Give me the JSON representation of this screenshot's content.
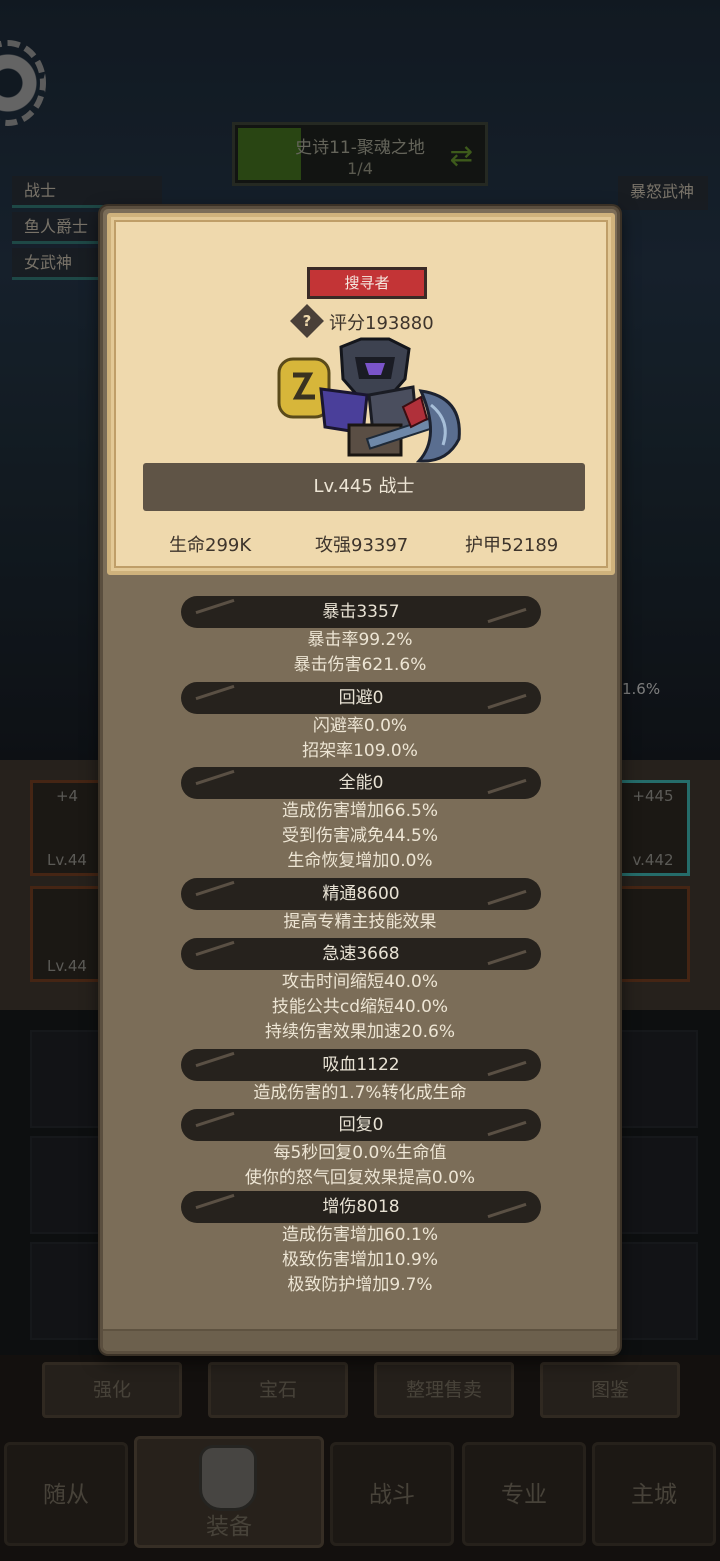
{
  "stage": {
    "title": "史诗11-聚魂之地",
    "progress": "1/4",
    "progress_fraction": 0.25
  },
  "team": [
    "战士",
    "鱼人爵士",
    "女武神"
  ],
  "enemy_label": "暴怒武神",
  "side_percent": "1.6%",
  "equip_slots": {
    "top_left_plus": "+4",
    "top_left_lv": "Lv.44",
    "bottom_left_lv": "Lv.44",
    "top_right_plus": "+445",
    "top_right_lv": "v.442"
  },
  "menu": [
    "强化",
    "宝石",
    "整理售卖",
    "图鉴"
  ],
  "tabs": [
    "随从",
    "装备",
    "战斗",
    "专业",
    "主城"
  ],
  "hero": {
    "role": "搜寻者",
    "score": "评分193880",
    "help": "?",
    "level": "Lv.445 战士",
    "hp": "生命299K",
    "attack": "攻强93397",
    "armor": "护甲52189"
  },
  "attributes": [
    {
      "name": "暴击3357",
      "details": [
        "暴击率99.2%",
        "暴击伤害621.6%"
      ]
    },
    {
      "name": "回避0",
      "details": [
        "闪避率0.0%",
        "招架率109.0%"
      ]
    },
    {
      "name": "全能0",
      "details": [
        "造成伤害增加66.5%",
        "受到伤害减免44.5%",
        "生命恢复增加0.0%"
      ]
    },
    {
      "name": "精通8600",
      "details": [
        "提高专精主技能效果"
      ]
    },
    {
      "name": "急速3668",
      "details": [
        "攻击时间缩短40.0%",
        "技能公共cd缩短40.0%",
        "持续伤害效果加速20.6%"
      ]
    },
    {
      "name": "吸血1122",
      "details": [
        "造成伤害的1.7%转化成生命"
      ]
    },
    {
      "name": "回复0",
      "details": [
        "每5秒回复0.0%生命值",
        "使你的怒气回复效果提高0.0%"
      ]
    },
    {
      "name": "增伤8018",
      "details": [
        "造成伤害增加60.1%",
        "极致伤害增加10.9%",
        "极致防护增加9.7%"
      ]
    }
  ],
  "colors": {
    "modal_bg": "#7b6d58",
    "card_bg": "#efd9ad",
    "role_badge": "#c33436",
    "header_pill": "#26221d"
  }
}
